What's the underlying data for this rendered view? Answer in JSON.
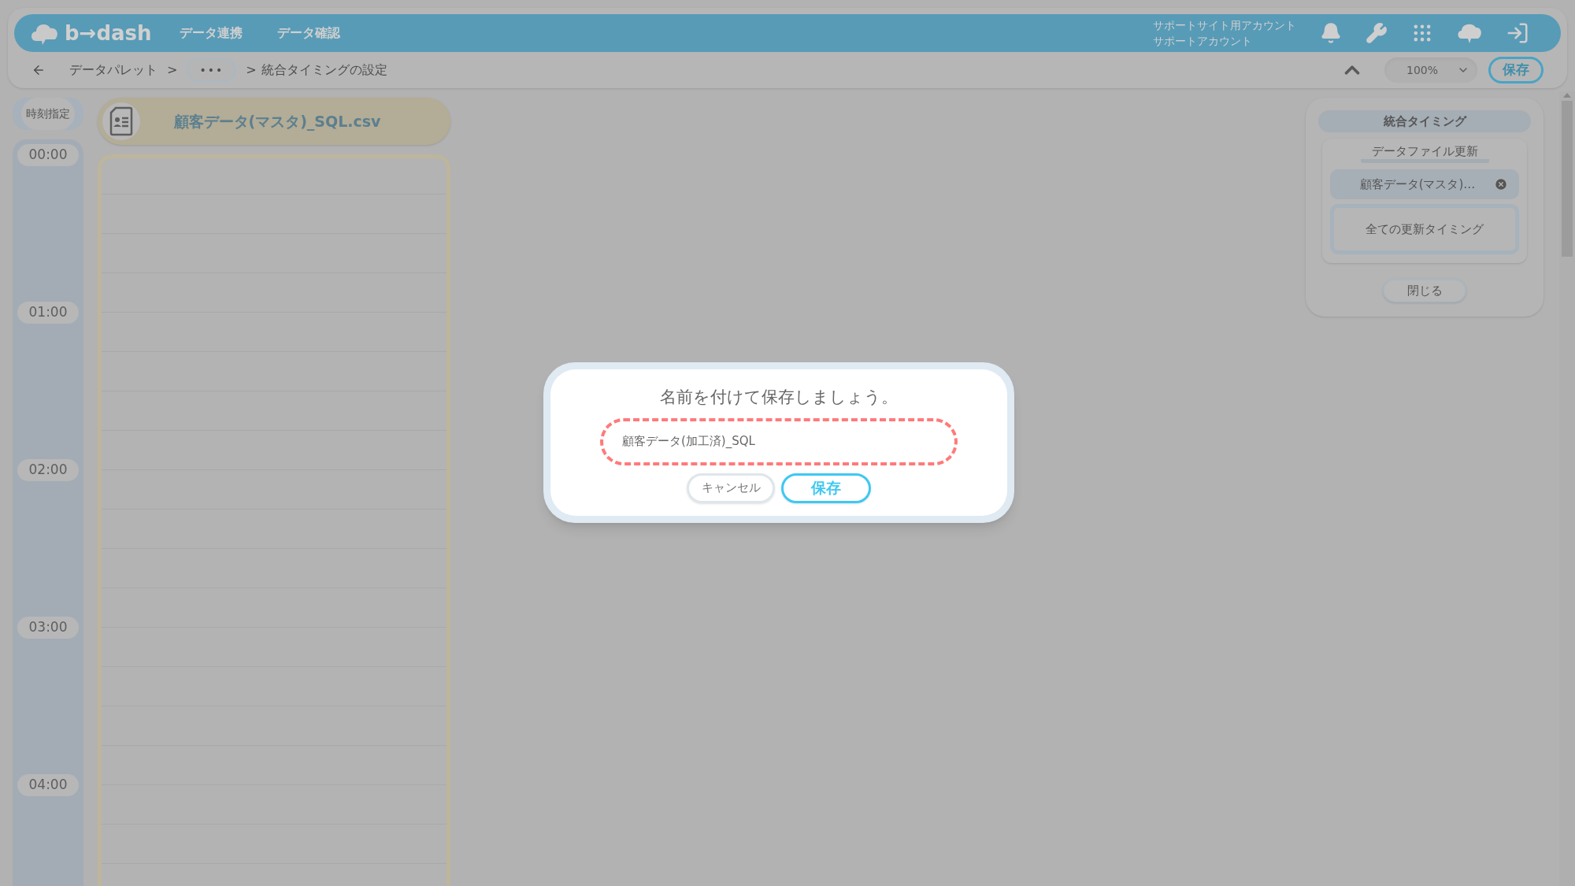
{
  "header": {
    "logo": "b→dash",
    "nav": [
      "データ連携",
      "データ確認"
    ],
    "account": [
      "サポートサイト用アカウント",
      "サポートアカウント"
    ]
  },
  "breadcrumb": {
    "items": [
      {
        "kind": "link",
        "label": "データパレット"
      },
      {
        "kind": "sep",
        "label": ">"
      },
      {
        "kind": "more",
        "label": "•••"
      },
      {
        "kind": "sep",
        "label": ">"
      },
      {
        "kind": "current",
        "label": "統合タイミングの設定"
      }
    ]
  },
  "toolbar": {
    "zoom": "100%",
    "save": "保存"
  },
  "time_column": {
    "title": "時刻指定",
    "times": [
      "00:00",
      "01:00",
      "02:00",
      "03:00",
      "04:00"
    ]
  },
  "file_column": {
    "name": "顧客データ(マスタ)_SQL.csv"
  },
  "panel": {
    "title": "統合タイミング",
    "section": "データファイル更新",
    "chip": "顧客データ(マスタ)…",
    "option": "全ての更新タイミング",
    "close": "閉じる"
  },
  "dialog": {
    "title": "名前を付けて保存しましょう。",
    "value": "顧客データ(加工済)_SQL",
    "cancel": "キャンセル",
    "save": "保存"
  }
}
